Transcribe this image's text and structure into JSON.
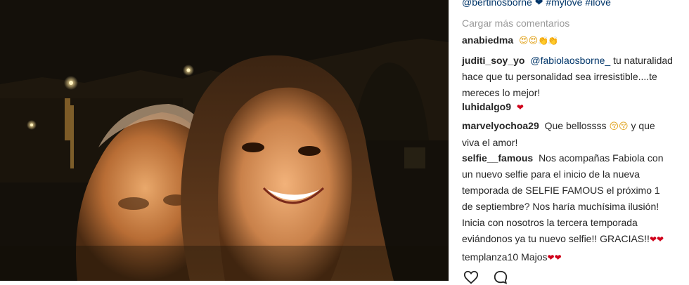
{
  "post": {
    "caption_tail": "@bertinosborne ❤ #mylove #ilove",
    "load_more": "Cargar más comentarios"
  },
  "comments": [
    {
      "user": "anabiedma",
      "text": "",
      "emojis": "😍😍",
      "extra": "👏👏"
    },
    {
      "user": "juditi_soy_yo",
      "mention": "@fabiolaosborne_",
      "text": "tu naturalidad hace que tu personalidad sea irresistible....te mereces lo mejor!"
    },
    {
      "user": "luhidalgo9",
      "text": "",
      "heart": "❤"
    },
    {
      "user": "marvelyochoa29",
      "text": "Que bellossss",
      "emojis": "😚😚",
      "text2": "y que viva el amor!"
    },
    {
      "user": "selfie__famous",
      "text": "Nos acompañas Fabiola con un nuevo selfie para el inicio de la nueva temporada de SELFIE FAMOUS el próximo 1 de septiembre? Nos haría muchísima ilusión! Inicia con nosotros la tercera temporada eviándonos ya tu nuevo selfie!! GRACIAS!!",
      "hearts": "❤❤"
    },
    {
      "user": "templanza10",
      "text": "Majos",
      "hearts": "❤❤"
    }
  ],
  "actions": {
    "like_icon": "heart-outline-icon",
    "comment_icon": "speech-bubble-icon"
  },
  "colors": {
    "link": "#003569",
    "heart": "#d0021b",
    "muted": "#999999"
  }
}
